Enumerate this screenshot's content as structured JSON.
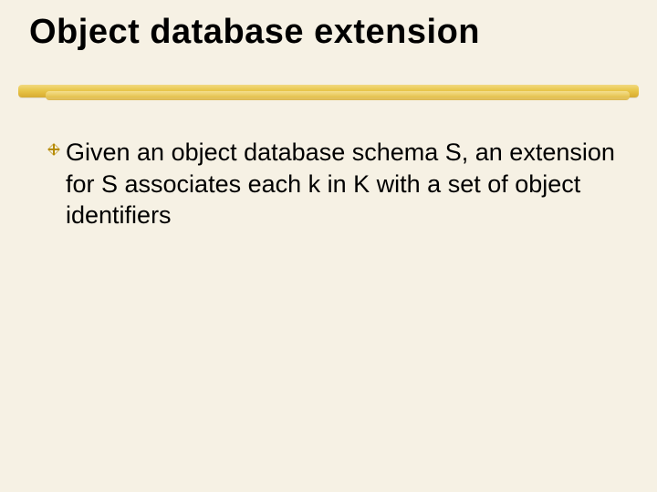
{
  "slide": {
    "title": "Object database extension",
    "bullets": [
      {
        "icon": "decorative-bullet-icon",
        "text": "Given an object database schema S, an extension for S associates each k in K with a set of object identifiers"
      }
    ],
    "accent_color": "#b68b00"
  }
}
